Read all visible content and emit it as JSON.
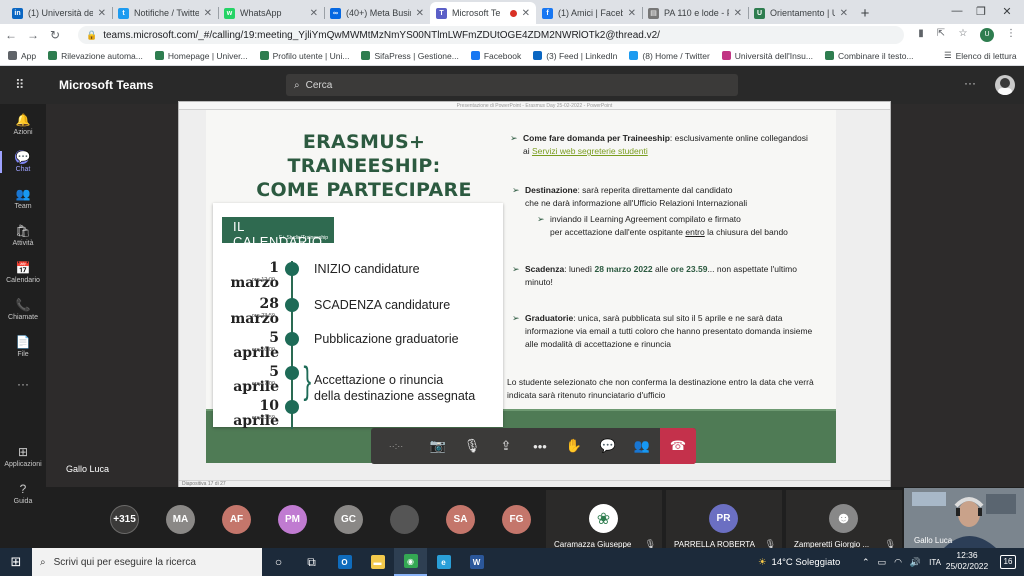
{
  "browser": {
    "tabs": [
      {
        "title": "(1) Università deg",
        "icon": "linkedin-icon",
        "color": "#0a66c2",
        "glyph": "in"
      },
      {
        "title": "Notifiche / Twitte",
        "icon": "twitter-icon",
        "color": "#1d9bf0",
        "glyph": "t"
      },
      {
        "title": "WhatsApp",
        "icon": "whatsapp-icon",
        "color": "#25d366",
        "glyph": "w"
      },
      {
        "title": "(40+) Meta Busin",
        "icon": "meta-icon",
        "color": "#0668e1",
        "glyph": "∞"
      },
      {
        "title": "Microsoft Te",
        "icon": "teams-icon",
        "color": "#5b5fc7",
        "glyph": "T",
        "active": true
      },
      {
        "title": "(1) Amici | Facebo",
        "icon": "facebook-icon",
        "color": "#1877f2",
        "glyph": "f"
      },
      {
        "title": "PA 110 e lode - F",
        "icon": "document-icon",
        "color": "#777777",
        "glyph": "▤"
      },
      {
        "title": "Orientamento | U",
        "icon": "university-icon",
        "color": "#2e7d4f",
        "glyph": "U"
      }
    ],
    "url": "teams.microsoft.com/_#/calling/19:meeting_YjliYmQwMWMtMzNmYS00NTlmLWFmZDUtOGE4ZDM2NWRlOTk2@thread.v2/",
    "bookmarks": [
      {
        "label": "App",
        "color": "#5f6368"
      },
      {
        "label": "Rilevazione automa...",
        "color": "#2e7d4f"
      },
      {
        "label": "Homepage | Univer...",
        "color": "#2e7d4f"
      },
      {
        "label": "Profilo utente | Uni...",
        "color": "#2e7d4f"
      },
      {
        "label": "SifaPress | Gestione...",
        "color": "#2e7d4f"
      },
      {
        "label": "Facebook",
        "color": "#1877f2"
      },
      {
        "label": "(3) Feed | LinkedIn",
        "color": "#0a66c2"
      },
      {
        "label": "(8) Home / Twitter",
        "color": "#1d9bf0"
      },
      {
        "label": "Università dell'Insu...",
        "color": "#c13584"
      },
      {
        "label": "Combinare il testo...",
        "color": "#2e7d4f"
      }
    ],
    "reading_list": "Elenco di lettura"
  },
  "teams": {
    "app_name": "Microsoft Teams",
    "search_placeholder": "Cerca",
    "rail": [
      {
        "label": "Azioni",
        "icon": "bell-icon",
        "glyph": "🔔"
      },
      {
        "label": "Chat",
        "icon": "chat-icon",
        "glyph": "💬",
        "active": true
      },
      {
        "label": "Team",
        "icon": "team-icon",
        "glyph": "👥"
      },
      {
        "label": "Attività",
        "icon": "activity-icon",
        "glyph": "🛍"
      },
      {
        "label": "Calendario",
        "icon": "calendar-icon",
        "glyph": "📅"
      },
      {
        "label": "Chiamate",
        "icon": "phone-icon",
        "glyph": "📞"
      },
      {
        "label": "File",
        "icon": "file-icon",
        "glyph": "📄"
      },
      {
        "label": "",
        "icon": "more-icon",
        "glyph": "···"
      }
    ],
    "rail_bottom": [
      {
        "label": "Applicazioni",
        "icon": "apps-icon",
        "glyph": "⊞"
      },
      {
        "label": "Guida",
        "icon": "help-icon",
        "glyph": "?"
      }
    ],
    "speaker_name": "Gallo Luca"
  },
  "slide": {
    "window_title": "Presentazione di PowerPoint - Erasmus Day 25-02-2022 - PowerPoint",
    "status_left": "Diapositiva 17 di 27",
    "title_line1": "ERASMUS+ TRAINEESHIP:",
    "title_line2": "COME PARTECIPARE",
    "calendar_heading": "IL CALENDARIO",
    "calendar_sub": "E+ Studio/Traineeship",
    "calendar": [
      {
        "date": "1 marzo",
        "time": "ore 12:00",
        "event": "INIZIO candidature"
      },
      {
        "date": "28 marzo",
        "time": "ore 23:59",
        "event": "SCADENZA candidature"
      },
      {
        "date": "5 aprile",
        "time": "ore 16:00",
        "event": "Pubblicazione graduatorie"
      },
      {
        "date": "5 aprile",
        "time": "ore 17:00",
        "event": ""
      },
      {
        "date": "10 aprile",
        "time": "ore 23:59",
        "event": ""
      }
    ],
    "bracket_event_line1": "Accettazione o rinuncia",
    "bracket_event_line2": "della destinazione assegnata",
    "b1_bold": "Come fare domanda per Traineeship",
    "b1_rest": ": esclusivamente online collegandosi",
    "b1_l2a": "ai ",
    "b1_link": "Servizi web segreterie studenti",
    "b2_bold": "Destinazione",
    "b2_rest": ": sarà reperita direttamente dal candidato",
    "b2_l2": "che ne darà informazione all'Ufficio Relazioni Internazionali",
    "b2_sub1": "inviando il Learning Agreement compilato e firmato",
    "b2_sub2a": "per accettazione dall'ente ospitante ",
    "b2_sub2u": "entro",
    "b2_sub2b": " la chiusura del bando",
    "b3_bold": "Scadenza",
    "b3_a": ": lunedì ",
    "b3_date": "28 marzo 2022",
    "b3_b": " alle ",
    "b3_time": "ore 23.59",
    "b3_c": "... non aspettate l'ultimo",
    "b3_l2": "minuto!",
    "b4_bold": "Graduatorie",
    "b4_rest": ": unica, sarà pubblicata sul sito il 5 aprile e ne sarà data",
    "b4_l2": "informazione via email a tutti coloro che hanno presentato domanda insieme",
    "b4_l3": "alle modalità di accettazione e rinuncia",
    "note_l1": "Lo studente selezionato che non conferma la destinazione entro la data che verrà",
    "note_l2": "indicata sarà ritenuto rinunciatario d'ufficio"
  },
  "callbar": {
    "timer": "··:··",
    "buttons": [
      {
        "name": "camera-off-button",
        "glyph": "📷"
      },
      {
        "name": "mic-off-button",
        "glyph": "🎙"
      },
      {
        "name": "share-button",
        "glyph": "⇪"
      },
      {
        "name": "more-button",
        "glyph": "•••"
      },
      {
        "name": "raise-hand-button",
        "glyph": "✋"
      },
      {
        "name": "chat-button",
        "glyph": "💬"
      },
      {
        "name": "participants-button",
        "glyph": "👥"
      }
    ],
    "hangup_glyph": "☎"
  },
  "participants": {
    "overflow": "+315",
    "avatars": [
      {
        "initials": "MA",
        "color": "#8a8886"
      },
      {
        "initials": "AF",
        "color": "#c4766b"
      },
      {
        "initials": "PM",
        "color": "#c07bd1"
      },
      {
        "initials": "GC",
        "color": "#8a8886"
      },
      {
        "initials": "",
        "color": "#555555"
      },
      {
        "initials": "SA",
        "color": "#c4766b"
      },
      {
        "initials": "FG",
        "color": "#c4766b"
      }
    ],
    "tiles": [
      {
        "name": "Caramazza Giuseppe",
        "initials": "",
        "color": "#ffffff"
      },
      {
        "name": "PARRELLA ROBERTA",
        "initials": "PR",
        "color": "#6b6fc2"
      },
      {
        "name": "Zamperetti Giorgio ...",
        "initials": "",
        "color": "#888888"
      }
    ],
    "self_name": "Gallo Luca"
  },
  "taskbar": {
    "search_placeholder": "Scrivi qui per eseguire la ricerca",
    "apps": [
      {
        "name": "cortana-icon",
        "glyph": "○",
        "color": ""
      },
      {
        "name": "task-view-icon",
        "glyph": "⧉",
        "color": ""
      },
      {
        "name": "outlook-icon",
        "glyph": "O",
        "color": "#0f6cbd"
      },
      {
        "name": "file-explorer-icon",
        "glyph": "▬",
        "color": "#f2c94c"
      },
      {
        "name": "chrome-icon",
        "glyph": "◉",
        "color": "#34a853",
        "active": true
      },
      {
        "name": "edge-icon",
        "glyph": "e",
        "color": "#2a9fd8"
      },
      {
        "name": "word-icon",
        "glyph": "W",
        "color": "#2b579a"
      }
    ],
    "weather": "14°C  Soleggiato",
    "time": "12:36",
    "date": "25/02/2022",
    "notifications": "16"
  }
}
